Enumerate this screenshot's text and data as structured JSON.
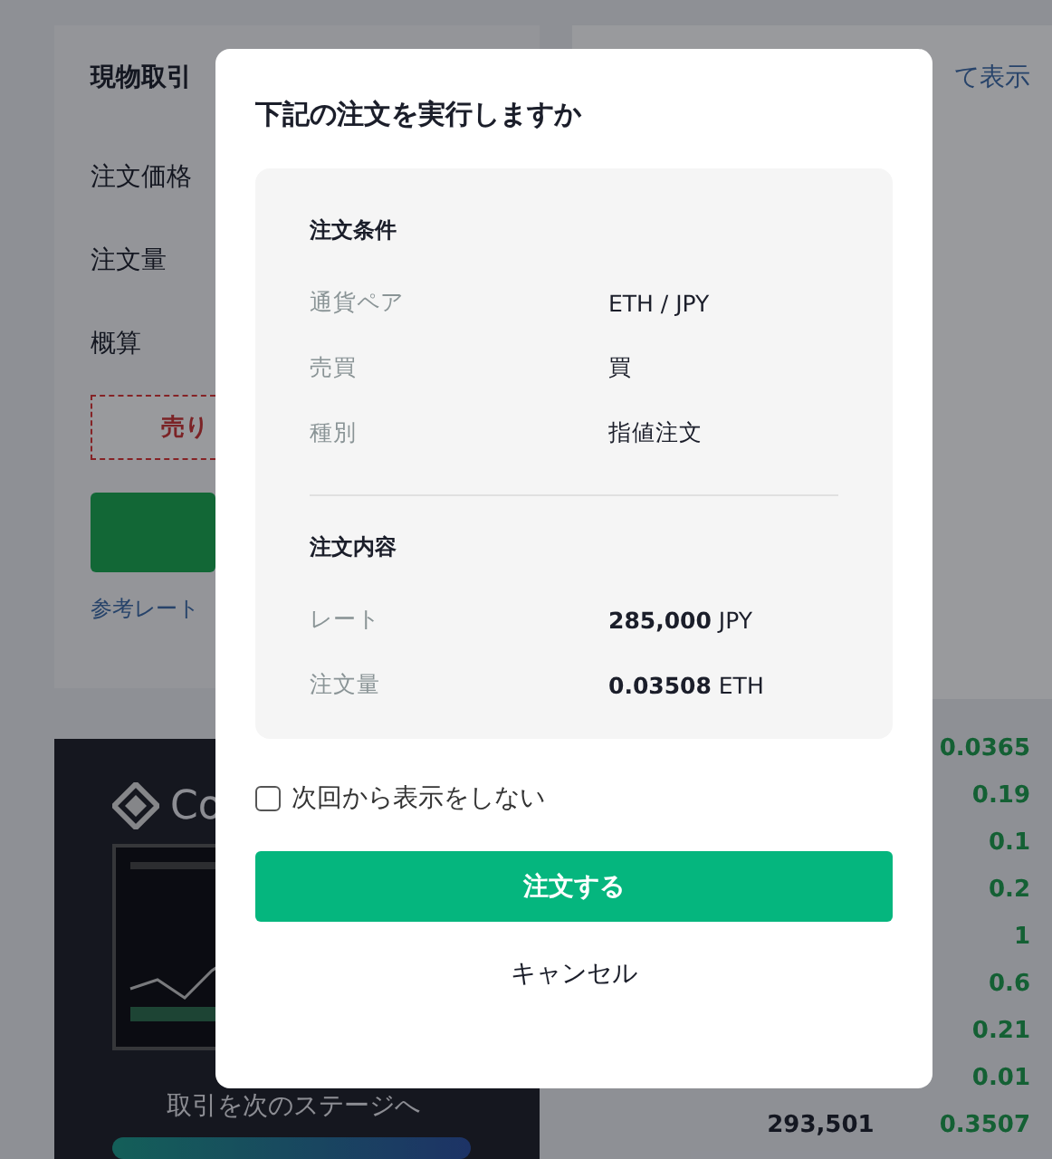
{
  "background": {
    "panel_title": "現物取引",
    "fields": [
      "注文価格",
      "注文量",
      "概算"
    ],
    "sell_button": "売り",
    "reference_rate": "参考レート",
    "show_all_link": "て表示",
    "banner": {
      "logo_text": "Co",
      "tagline": "取引を次のステージへ"
    },
    "order_book": [
      {
        "amount": "0.0365"
      },
      {
        "amount": "0.19"
      },
      {
        "amount": "0.1"
      },
      {
        "amount": "0.2"
      },
      {
        "amount": "1"
      },
      {
        "amount": "0.6"
      },
      {
        "amount": "0.21"
      },
      {
        "amount": "0.01"
      },
      {
        "price": "293,501",
        "amount": "0.3507"
      }
    ]
  },
  "dialog": {
    "title": "下記の注文を実行しますか",
    "sections": [
      {
        "heading": "注文条件",
        "rows": [
          {
            "label": "通貨ペア",
            "value": "ETH / JPY"
          },
          {
            "label": "売買",
            "value": "買"
          },
          {
            "label": "種別",
            "value": "指値注文"
          }
        ]
      },
      {
        "heading": "注文内容",
        "rows": [
          {
            "label": "レート",
            "value": "**285,000** JPY"
          },
          {
            "label": "注文量",
            "value": "**0.03508** ETH"
          }
        ]
      }
    ],
    "checkbox": {
      "label": "次回から表示をしない",
      "checked": false
    },
    "confirm_button": "注文する",
    "cancel_button": "キャンセル"
  }
}
